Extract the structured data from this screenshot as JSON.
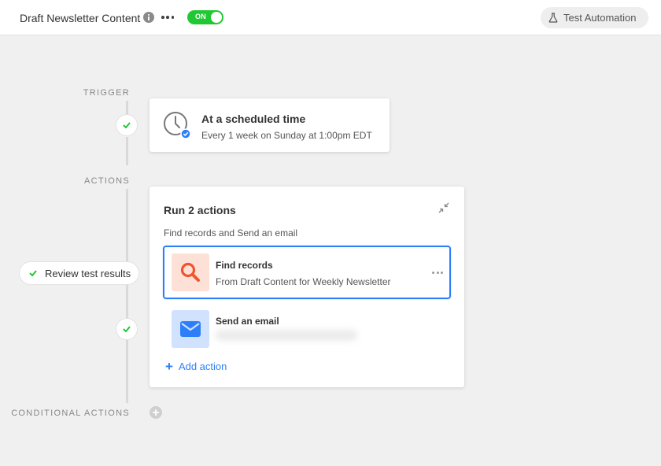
{
  "header": {
    "title": "Draft Newsletter Content",
    "toggle_label": "ON",
    "test_button_label": "Test Automation"
  },
  "timeline": {
    "trigger_label": "TRIGGER",
    "actions_label": "ACTIONS",
    "conditional_label": "CONDITIONAL ACTIONS",
    "review_label": "Review test results"
  },
  "trigger": {
    "title": "At a scheduled time",
    "subtitle": "Every 1 week on Sunday at 1:00pm EDT",
    "icon": "clock-icon"
  },
  "actions": {
    "title": "Run 2 actions",
    "subtitle": "Find records and Send an email",
    "items": [
      {
        "title": "Find records",
        "subtitle": "From Draft Content for Weekly Newsletter",
        "icon": "search-icon",
        "selected": true
      },
      {
        "title": "Send an email",
        "subtitle": "",
        "icon": "envelope-icon",
        "selected": false
      }
    ],
    "add_label": "Add action"
  },
  "colors": {
    "accent": "#2d7ff9",
    "toggle_on": "#20c933",
    "check": "#20c933",
    "find_icon": "#f0542e",
    "find_bg": "#fde1d6",
    "email_icon": "#2d7ff9",
    "email_bg": "#d1e2ff"
  }
}
